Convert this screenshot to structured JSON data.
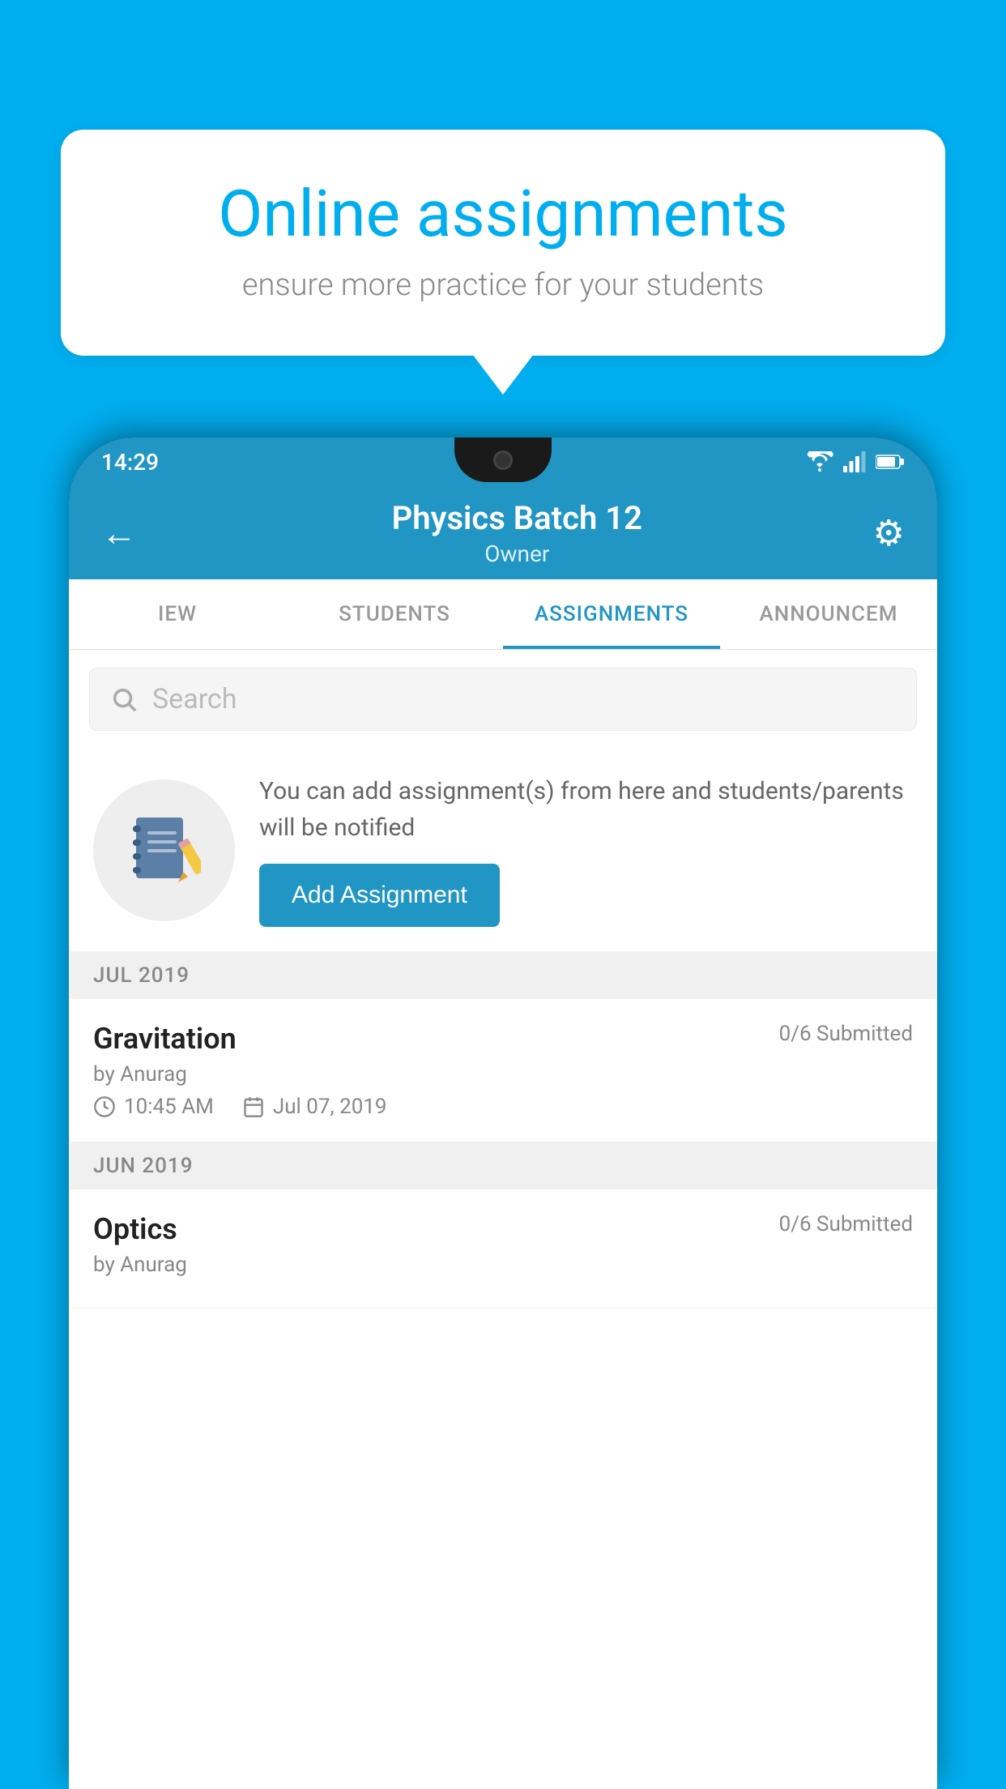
{
  "background_color": "#00AEEF",
  "speech_bubble": {
    "title": "Online assignments",
    "subtitle": "ensure more practice for your students"
  },
  "phone": {
    "status_bar": {
      "time": "14:29",
      "icons": [
        "wifi",
        "signal",
        "battery"
      ]
    },
    "app_bar": {
      "title": "Physics Batch 12",
      "subtitle": "Owner",
      "back_label": "←",
      "settings_label": "⚙"
    },
    "tabs": [
      {
        "label": "IEW",
        "active": false
      },
      {
        "label": "STUDENTS",
        "active": false
      },
      {
        "label": "ASSIGNMENTS",
        "active": true
      },
      {
        "label": "ANNOUNCEM",
        "active": false
      }
    ],
    "search": {
      "placeholder": "Search"
    },
    "empty_state": {
      "description": "You can add assignment(s) from here and students/parents will be notified",
      "button_label": "Add Assignment"
    },
    "month_groups": [
      {
        "month_label": "JUL 2019",
        "assignments": [
          {
            "name": "Gravitation",
            "submitted": "0/6 Submitted",
            "author": "by Anurag",
            "time": "10:45 AM",
            "date": "Jul 07, 2019"
          }
        ]
      },
      {
        "month_label": "JUN 2019",
        "assignments": [
          {
            "name": "Optics",
            "submitted": "0/6 Submitted",
            "author": "by Anurag",
            "time": "",
            "date": ""
          }
        ]
      }
    ]
  }
}
